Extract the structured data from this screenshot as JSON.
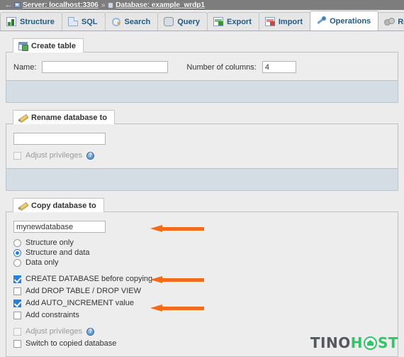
{
  "breadcrumb": {
    "back_icon": "back-arrow-icon",
    "server": "Server: localhost:3306",
    "separator": "»",
    "database": "Database: example_wrdp1"
  },
  "tabs": [
    {
      "label": "Structure",
      "icon": "structure-icon",
      "active": false
    },
    {
      "label": "SQL",
      "icon": "sql-icon",
      "active": false
    },
    {
      "label": "Search",
      "icon": "search-icon",
      "active": false
    },
    {
      "label": "Query",
      "icon": "query-icon",
      "active": false
    },
    {
      "label": "Export",
      "icon": "export-icon",
      "active": false
    },
    {
      "label": "Import",
      "icon": "import-icon",
      "active": false
    },
    {
      "label": "Operations",
      "icon": "wrench-icon",
      "active": true
    },
    {
      "label": "Routines",
      "icon": "routines-icon",
      "active": false
    }
  ],
  "create_table": {
    "legend": "Create table",
    "legend_icon": "new-table-icon",
    "name_label": "Name:",
    "name_value": "",
    "name_placeholder": "",
    "columns_label": "Number of columns:",
    "columns_value": "4"
  },
  "rename_database": {
    "legend": "Rename database to",
    "legend_icon": "pencil-icon",
    "input_value": "",
    "adjust_privileges": {
      "label": "Adjust privileges",
      "checked": false,
      "disabled": true
    },
    "help_icon": "help-info-icon",
    "help_glyph": "?"
  },
  "copy_database": {
    "legend": "Copy database to",
    "legend_icon": "pencil-icon",
    "input_value": "mynewdatabase",
    "radios": [
      {
        "label": "Structure only",
        "checked": false
      },
      {
        "label": "Structure and data",
        "checked": true
      },
      {
        "label": "Data only",
        "checked": false
      }
    ],
    "checkboxes": [
      {
        "label": "CREATE DATABASE before copying",
        "checked": true,
        "disabled": false
      },
      {
        "label": "Add DROP TABLE / DROP VIEW",
        "checked": false,
        "disabled": false
      },
      {
        "label": "Add AUTO_INCREMENT value",
        "checked": true,
        "disabled": false
      },
      {
        "label": "Add constraints",
        "checked": false,
        "disabled": false
      },
      {
        "label": "Adjust privileges",
        "checked": false,
        "disabled": true
      },
      {
        "label": "Switch to copied database",
        "checked": false,
        "disabled": false
      }
    ],
    "help_glyph": "?"
  },
  "annotations": {
    "accent_color": "#f26a1b",
    "arrows": [
      {
        "name": "arrow-copy-name",
        "points_to": "copy database name input"
      },
      {
        "name": "arrow-create-db",
        "points_to": "CREATE DATABASE before copying checkbox"
      },
      {
        "name": "arrow-autoinc",
        "points_to": "Add AUTO_INCREMENT value checkbox"
      }
    ]
  },
  "watermark": {
    "text_dark": "TINO",
    "text_green_1": "H",
    "text_green_2": "ST",
    "icon": "house-in-circle-icon",
    "dark_color": "#55595b",
    "green_color": "#35c26a"
  }
}
